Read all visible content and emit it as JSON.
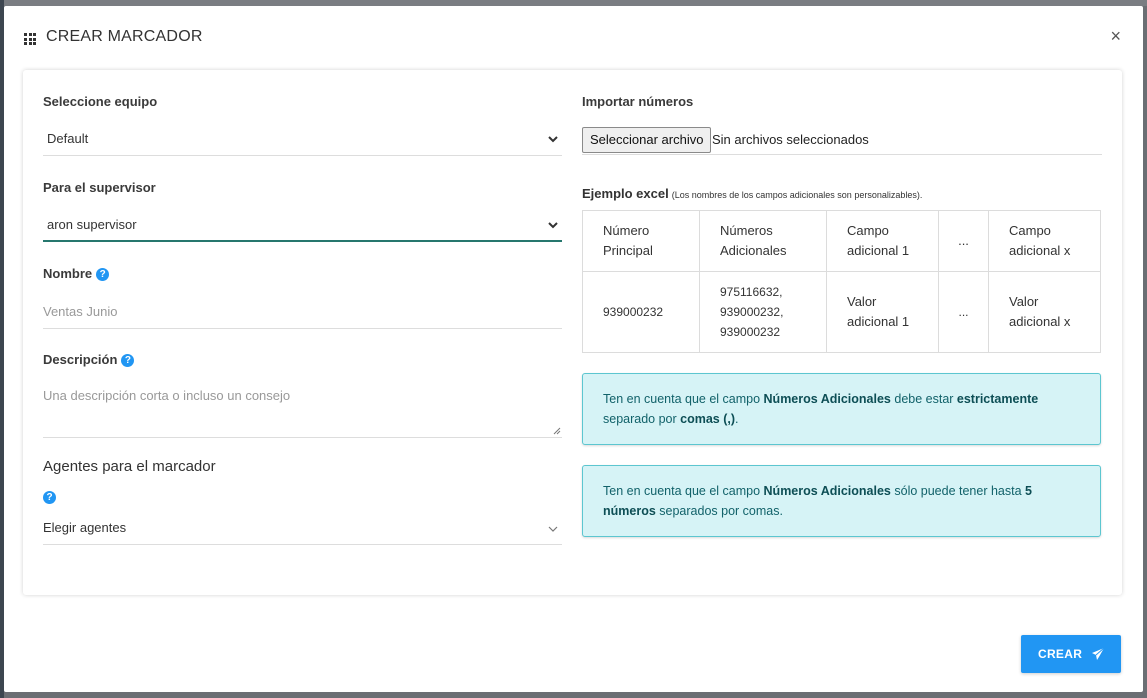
{
  "modal": {
    "title": "CREAR MARCADOR",
    "close_label": "×"
  },
  "form": {
    "team": {
      "label": "Seleccione equipo",
      "value": "Default"
    },
    "supervisor": {
      "label": "Para el supervisor",
      "value": "aron supervisor"
    },
    "name": {
      "label": "Nombre",
      "placeholder": "Ventas Junio",
      "help": "?"
    },
    "description": {
      "label": "Descripción",
      "placeholder": "Una descripción corta o incluso un consejo",
      "help": "?"
    },
    "agents": {
      "title": "Agentes para el marcador",
      "help": "?",
      "value": "Elegir agentes"
    }
  },
  "import": {
    "label": "Importar números",
    "file_button": "Seleccionar archivo",
    "file_status": "Sin archivos seleccionados",
    "example_label": "Ejemplo excel",
    "example_note": "(Los nombres de los campos adicionales son personalizables).",
    "table": {
      "headers": [
        "Número Principal",
        "Números Adicionales",
        "Campo adicional 1",
        "...",
        "Campo adicional x"
      ],
      "row": [
        "939000232",
        "975116632, 939000232, 939000232",
        "Valor adicional 1",
        "...",
        "Valor adicional x"
      ]
    },
    "alert1": {
      "t1": "Ten en cuenta que el campo ",
      "b1": "Números Adicionales",
      "t2": " debe estar ",
      "b2": "estrictamente",
      "t3": " separado por ",
      "b3": "comas (,)",
      "t4": "."
    },
    "alert2": {
      "t1": "Ten en cuenta que el campo ",
      "b1": "Números Adicionales",
      "t2": " sólo puede tener hasta ",
      "b2": "5 números",
      "t3": " separados por comas."
    }
  },
  "actions": {
    "create_label": "CREAR"
  },
  "colors": {
    "primary": "#2196f3",
    "alert_bg": "#d6f3f6",
    "alert_border": "#5cc6d0",
    "focus_underline": "#26776e"
  },
  "icons": {
    "title": "grid-icon",
    "close": "close-icon",
    "select": "chevron-down-icon",
    "help": "help-icon",
    "submit": "send-icon"
  }
}
